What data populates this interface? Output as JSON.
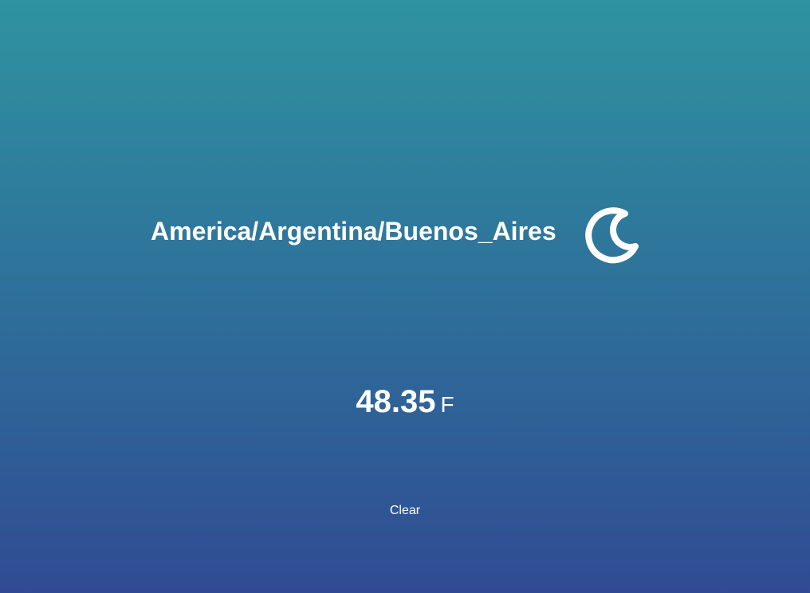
{
  "location": {
    "timezone": "America/Argentina/Buenos_Aires",
    "icon": "moon-icon"
  },
  "temperature": {
    "value": "48.35",
    "unit": "F"
  },
  "conditions": {
    "description": "Clear"
  },
  "colors": {
    "gradient_top": "#2f93a0",
    "gradient_middle": "#2e709a",
    "gradient_bottom": "#304b93",
    "text": "#ffffff"
  }
}
